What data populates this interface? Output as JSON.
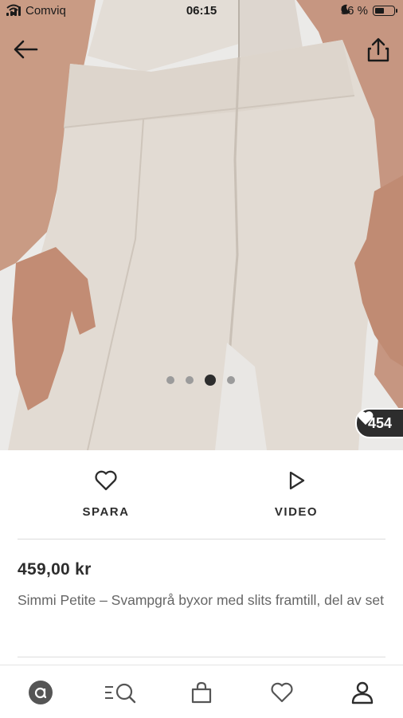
{
  "status_bar": {
    "carrier": "Comviq",
    "time": "06:15",
    "battery_text": "56 %",
    "battery_level": 0.56
  },
  "header": {
    "back_icon": "arrow-left-icon",
    "share_icon": "share-icon"
  },
  "gallery": {
    "total_images": 4,
    "active_index": 2,
    "likes_count": "454"
  },
  "actions": {
    "save_label": "SPARA",
    "video_label": "VIDEO"
  },
  "product": {
    "price": "459,00 kr",
    "title": "Simmi Petite – Svampgrå byxor med slits framtill, del av set"
  },
  "bottom_nav": {
    "items": [
      "home-icon",
      "search-icon",
      "bag-icon",
      "heart-icon",
      "account-icon"
    ]
  },
  "colors": {
    "dark": "#2d2d2d",
    "muted_text": "#666666",
    "divider": "#dddddd",
    "nav_icon": "#555555"
  }
}
